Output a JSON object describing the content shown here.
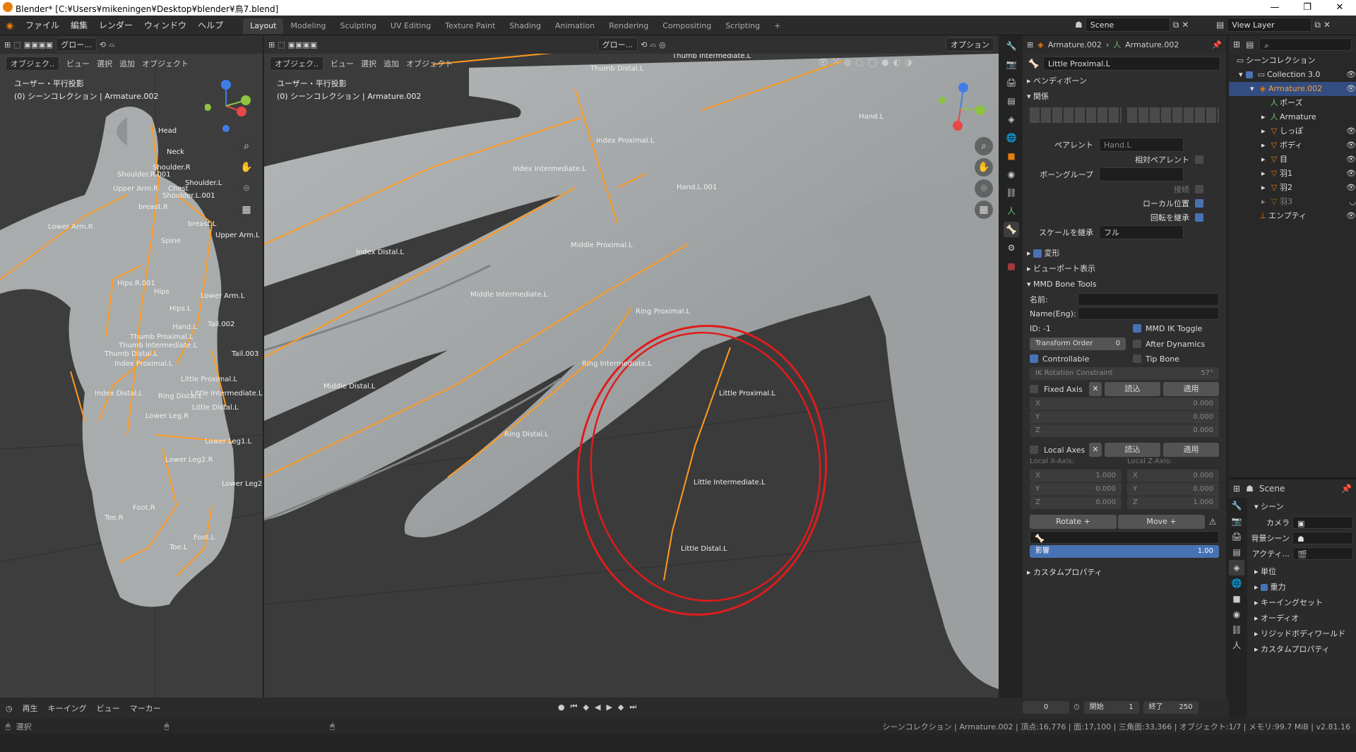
{
  "titlebar": {
    "title": "Blender* [C:¥Users¥mikeningen¥Desktop¥blender¥鳥7.blend]",
    "minimize": "—",
    "maximize": "❐",
    "close": "✕"
  },
  "menu": {
    "items": [
      "ファイル",
      "編集",
      "レンダー",
      "ウィンドウ",
      "ヘルプ"
    ]
  },
  "workspaces": {
    "tabs": [
      "Layout",
      "Modeling",
      "Sculpting",
      "UV Editing",
      "Texture Paint",
      "Shading",
      "Animation",
      "Rendering",
      "Compositing",
      "Scripting"
    ],
    "active": "Layout",
    "add": "+"
  },
  "scene_selector": {
    "scene": "Scene",
    "view_layer": "View Layer"
  },
  "left_viewport": {
    "mode": "オブジェク..",
    "menus": [
      "ビュー",
      "選択",
      "追加",
      "オブジェクト"
    ],
    "transform": "グロー...",
    "view_label": "ユーザー・平行投影",
    "collection_label": "(0) シーンコレクション | Armature.002",
    "bones": [
      "Head",
      "Neck",
      "Shoulder.R",
      "Shoulder.R.001",
      "Upper Arm.R",
      "Chest",
      "Shoulder.L",
      "Shoulder.L.001",
      "breast.R",
      "breast.L",
      "Lower Arm.R",
      "Spine",
      "Upper Arm.L",
      "Hips.R.001",
      "Hips",
      "Lower Arm.L",
      "Hips.L",
      "Hand.L",
      "Tail.002",
      "Thumb Proximal.L",
      "Thumb Intermediate.L",
      "Thumb Distal.L",
      "Index Proximal.L",
      "Little Proximal.L",
      "Tail.003",
      "Index Distal.L",
      "Ring Distal.L",
      "Little Intermediate.L",
      "Little Distal.L",
      "Lower Leg.R",
      "Lower Leg1.L",
      "Lower Leg2.R",
      "Lower Leg2",
      "Foot.R",
      "Toe.R",
      "Foot.L",
      "Toe.L"
    ]
  },
  "main_viewport": {
    "mode": "オブジェク..",
    "menus": [
      "ビュー",
      "選択",
      "追加",
      "オブジェクト"
    ],
    "transform": "グロー...",
    "options": "オプション",
    "view_label": "ユーザー・平行投影",
    "collection_label": "(0) シーンコレクション | Armature.002",
    "bones": [
      "Thumb Intermediate.L",
      "Thumb Distal.L",
      "Hand.L",
      "Index Proximal.L",
      "Index Intermediate.L",
      "Hand.L.001",
      "Index Distal.L",
      "Middle Proximal.L",
      "Middle Intermediate.L",
      "Ring Proximal.L",
      "Middle Distal.L",
      "Ring Intermediate.L",
      "Ring Distal.L",
      "Little Proximal.L",
      "Little Intermediate.L",
      "Little Distal.L"
    ],
    "annotation_color": "#e01b1b"
  },
  "properties": {
    "breadcrumb_object": "Armature.002",
    "breadcrumb_data": "Armature.002",
    "bone_name": "Little Proximal.L",
    "sections": {
      "bendy": "ベンディボーン",
      "relations": "関係",
      "deform": "変形",
      "viewport_display": "ビューポート表示",
      "mmd": "MMD Bone Tools",
      "custom_props": "カスタムプロパティ"
    },
    "parent_label": "ペアレント",
    "parent_value": "Hand.L",
    "relative_parent": "相対ペアレント",
    "bone_group_label": "ボーングループ",
    "connected": "接続",
    "local_location": "ローカル位置",
    "inherit_rotation": "回転を継承",
    "inherit_scale_label": "スケールを継承",
    "inherit_scale_value": "フル",
    "mmd": {
      "name_label": "名前:",
      "name_value": "",
      "name_eng_label": "Name(Eng):",
      "name_eng_value": "",
      "id": "ID: -1",
      "ik_toggle": "MMD IK Toggle",
      "transform_order_label": "Transform Order",
      "transform_order_value": "0",
      "after_dynamics": "After Dynamics",
      "controllable": "Controllable",
      "tip_bone": "Tip Bone",
      "ik_rotation_label": "IK Rotation Constraint",
      "ik_rotation_value": "57°",
      "fixed_axis": "Fixed Axis",
      "load": "読込",
      "apply": "適用",
      "fixed": {
        "x": "0.000",
        "y": "0.000",
        "z": "0.000"
      },
      "local_axes": "Local Axes",
      "local_x_label": "Local X-Axis:",
      "local_z_label": "Local Z-Axis:",
      "local_x": {
        "x": "1.000",
        "y": "0.000",
        "z": "0.000"
      },
      "local_z": {
        "x": "0.000",
        "y": "0.000",
        "z": "1.000"
      },
      "rotate_plus": "Rotate +",
      "move_plus": "Move +",
      "influence_label": "影響",
      "influence_value": "1.00"
    }
  },
  "outliner": {
    "root": "シーンコレクション",
    "collection": "Collection 3.0",
    "armature": "Armature.002",
    "children": [
      "ポーズ",
      "Armature",
      "しっぽ",
      "ボディ",
      "目",
      "羽1",
      "羽2",
      "羽3"
    ],
    "empty": "エンプティ"
  },
  "scene_panel": {
    "title": "Scene",
    "section": "シーン",
    "camera_label": "カメラ",
    "bg_scene_label": "背景シーン",
    "active_clip_label": "アクティ...",
    "items": [
      "単位",
      "重力",
      "キーイングセット",
      "オーディオ",
      "リジッドボディワールド",
      "カスタムプロパティ"
    ]
  },
  "timeline": {
    "playback": "再生",
    "keying": "キーイング",
    "view": "ビュー",
    "marker": "マーカー",
    "current_frame": "0",
    "start_label": "開始",
    "start": "1",
    "end_label": "終了",
    "end": "250"
  },
  "status": {
    "select": "選択",
    "stats": "シーンコレクション | Armature.002 | 頂点:16,776 | 面:17,100 | 三角面:33,366 | オブジェクト:1/7 | メモリ:99.7 MiB | v2.81.16"
  }
}
